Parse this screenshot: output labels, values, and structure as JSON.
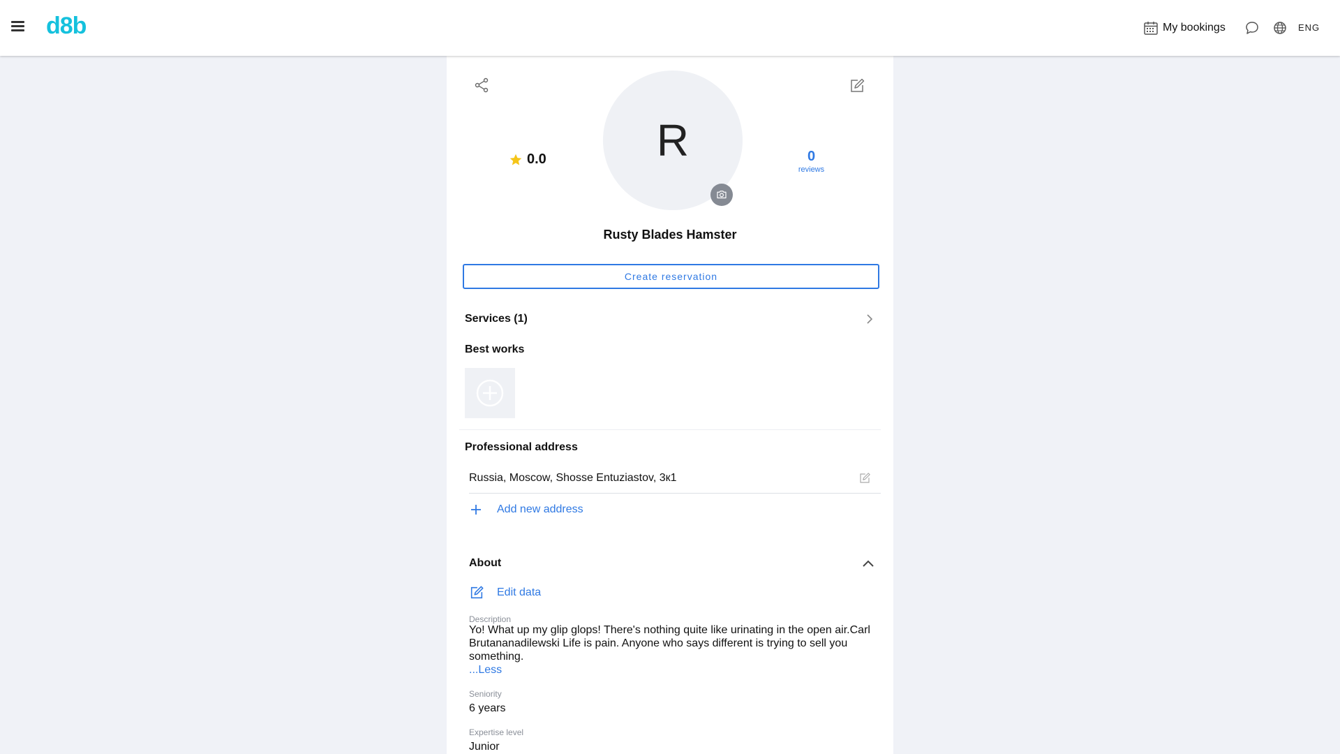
{
  "header": {
    "logo": "d8b",
    "bookings_label": "My bookings",
    "language": "ENG"
  },
  "profile": {
    "avatar_initial": "R",
    "rating": "0.0",
    "reviews_count": "0",
    "reviews_label": "reviews",
    "name": "Rusty Blades Hamster",
    "create_reservation_label": "Create reservation"
  },
  "services": {
    "label": "Services (1)"
  },
  "best_works": {
    "title": "Best works"
  },
  "address": {
    "title": "Professional address",
    "items": [
      "Russia, Moscow, Shosse Entuziastov, 3к1"
    ],
    "add_label": "Add new address"
  },
  "about": {
    "title": "About",
    "edit_label": "Edit data",
    "description_label": "Description",
    "description": "Yo! What up my glip glops! There's nothing quite like urinating in the open air.Carl Brutananadilewski Life is pain. Anyone who says different is trying to sell you something.",
    "less_label": "...Less",
    "seniority_label": "Seniority",
    "seniority": "6 years",
    "expertise_label": "Expertise level",
    "expertise": "Junior"
  },
  "colors": {
    "brand": "#15c1dd",
    "accent": "#2f79e3",
    "star": "#f5c518",
    "background": "#f0f2f7"
  },
  "icons": [
    "menu-icon",
    "calendar-icon",
    "chat-icon",
    "globe-icon",
    "share-icon",
    "edit-icon",
    "camera-icon",
    "star-icon",
    "chevron-right-icon",
    "add-circle-icon",
    "plus-icon",
    "chevron-up-icon"
  ]
}
